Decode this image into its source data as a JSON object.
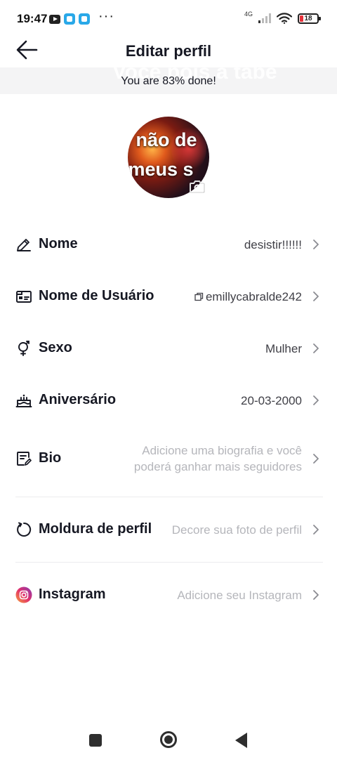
{
  "status_bar": {
    "time": "19:47",
    "dots": "···",
    "network": "4G",
    "battery": "18",
    "battery_color": "#e5323b"
  },
  "header": {
    "title": "Editar perfil",
    "back_icon": "arrow-left-icon"
  },
  "banner": {
    "text": "You are 83% done!",
    "progress_percent": 83,
    "ghost_text": "Você pois a tabe"
  },
  "avatar": {
    "caption_line1": "não de",
    "caption_line2": "meus s",
    "camera_icon": "camera-icon"
  },
  "rows": [
    {
      "key": "nome",
      "label": "Nome",
      "value": "desistir!!!!!!",
      "icon": "pencil-icon",
      "placeholder": false
    },
    {
      "key": "usuario",
      "label": "Nome de Usuário",
      "value": "emillycabralde242",
      "icon": "id-card-icon",
      "copy_icon": "copy-icon",
      "placeholder": false
    },
    {
      "key": "sexo",
      "label": "Sexo",
      "value": "Mulher",
      "icon": "gender-icon",
      "placeholder": false
    },
    {
      "key": "aniversario",
      "label": "Aniversário",
      "value": "20-03-2000",
      "icon": "cake-icon",
      "placeholder": false
    },
    {
      "key": "bio",
      "label": "Bio",
      "value_line1": "Adicione uma biografia e você",
      "value_line2": "poderá ganhar mais seguidores",
      "icon": "edit-note-icon",
      "placeholder": true
    },
    {
      "key": "moldura",
      "label": "Moldura de perfil",
      "value": "Decore sua foto de perfil",
      "icon": "frame-circle-icon",
      "placeholder": true
    },
    {
      "key": "instagram",
      "label": "Instagram",
      "value": "Adicione seu Instagram",
      "icon": "instagram-icon",
      "placeholder": true
    }
  ],
  "colors": {
    "primary_text": "#161823",
    "value_text": "#3f3f46",
    "placeholder_text": "#b5b6bb",
    "banner_bg": "#f4f4f5",
    "instagram_gradient_start": "#f9a13a",
    "instagram_gradient_end": "#c13584"
  },
  "nav_bar": {
    "recents_icon": "square-icon",
    "home_icon": "circle-icon",
    "back_icon": "triangle-back-icon"
  }
}
